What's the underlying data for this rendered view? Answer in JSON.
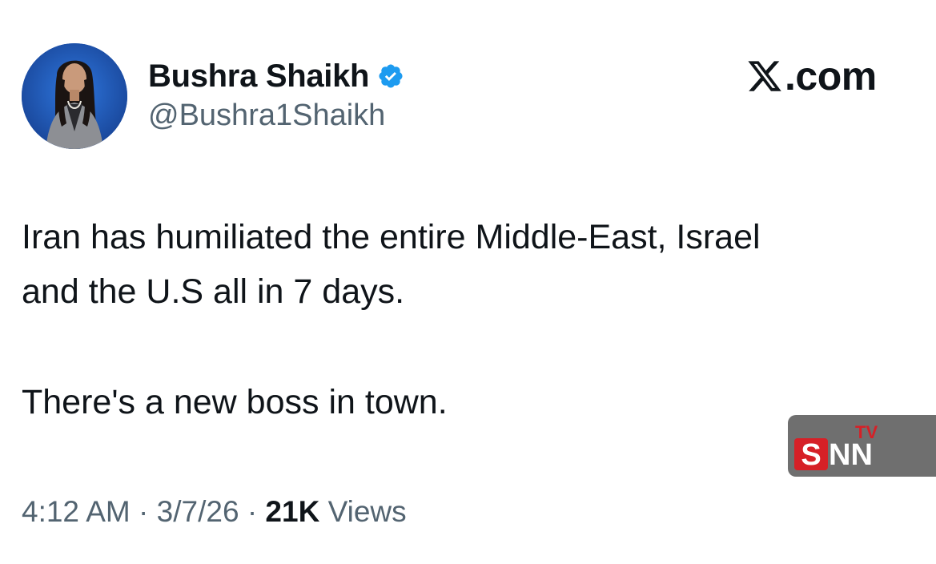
{
  "tweet": {
    "author": {
      "display_name": "Bushra Shaikh",
      "handle": "@Bushra1Shaikh",
      "verified": true,
      "avatar_icon": "profile-photo-icon"
    },
    "brand": {
      "logo_icon": "x-logo-icon",
      "text": ".com"
    },
    "text_lines": [
      "Iran has humiliated the entire Middle-East, Israel",
      "and the U.S all in 7 days.",
      "There's a new boss in town."
    ],
    "meta": {
      "time": "4:12 AM",
      "separator": "·",
      "date": "3/7/26",
      "views_count": "21K",
      "views_label": "Views"
    }
  },
  "watermark": {
    "text": "SNN",
    "superscript": "TV",
    "colors": {
      "background": "#6f6f6f",
      "accent": "#d62027",
      "text": "#ffffff"
    }
  },
  "colors": {
    "verified_badge": "#1d9bf0",
    "primary_text": "#0f1419",
    "secondary_text": "#536471",
    "avatar_background": "#1d57b8"
  }
}
